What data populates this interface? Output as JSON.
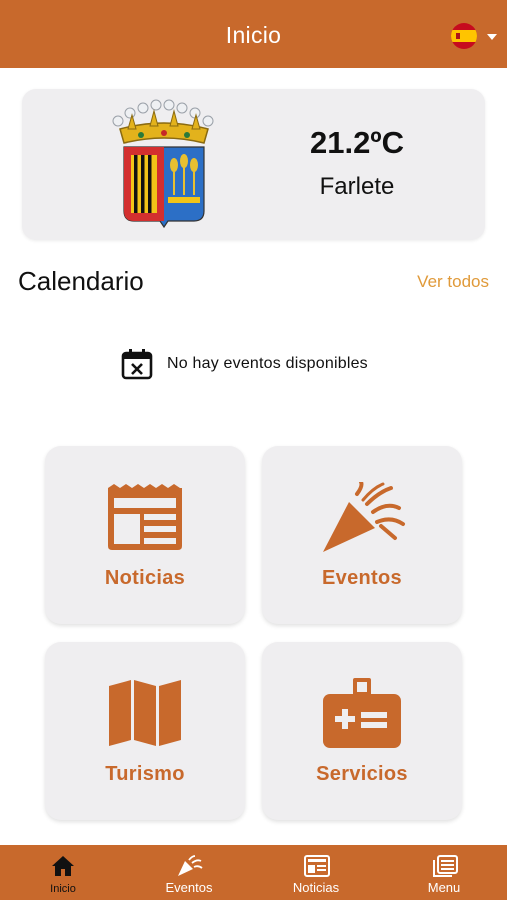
{
  "header": {
    "title": "Inicio",
    "language_icon": "spain-flag-icon"
  },
  "weather": {
    "temperature": "21.2ºC",
    "location": "Farlete"
  },
  "calendar": {
    "title": "Calendario",
    "see_all": "Ver todos",
    "empty_message": "No hay eventos disponibles"
  },
  "tiles": [
    {
      "label": "Noticias",
      "icon": "newspaper-icon"
    },
    {
      "label": "Eventos",
      "icon": "party-popper-icon"
    },
    {
      "label": "Turismo",
      "icon": "map-icon"
    },
    {
      "label": "Servicios",
      "icon": "first-aid-case-icon"
    }
  ],
  "tabbar": {
    "items": [
      {
        "label": "Inicio",
        "icon": "home-icon",
        "active": true
      },
      {
        "label": "Eventos",
        "icon": "party-popper-icon",
        "active": false
      },
      {
        "label": "Noticias",
        "icon": "newspaper-icon",
        "active": false
      },
      {
        "label": "Menu",
        "icon": "menu-book-icon",
        "active": false
      }
    ]
  },
  "colors": {
    "brand": "#c8692c",
    "accent_link": "#e09a3a",
    "card_bg": "#efeef0"
  }
}
